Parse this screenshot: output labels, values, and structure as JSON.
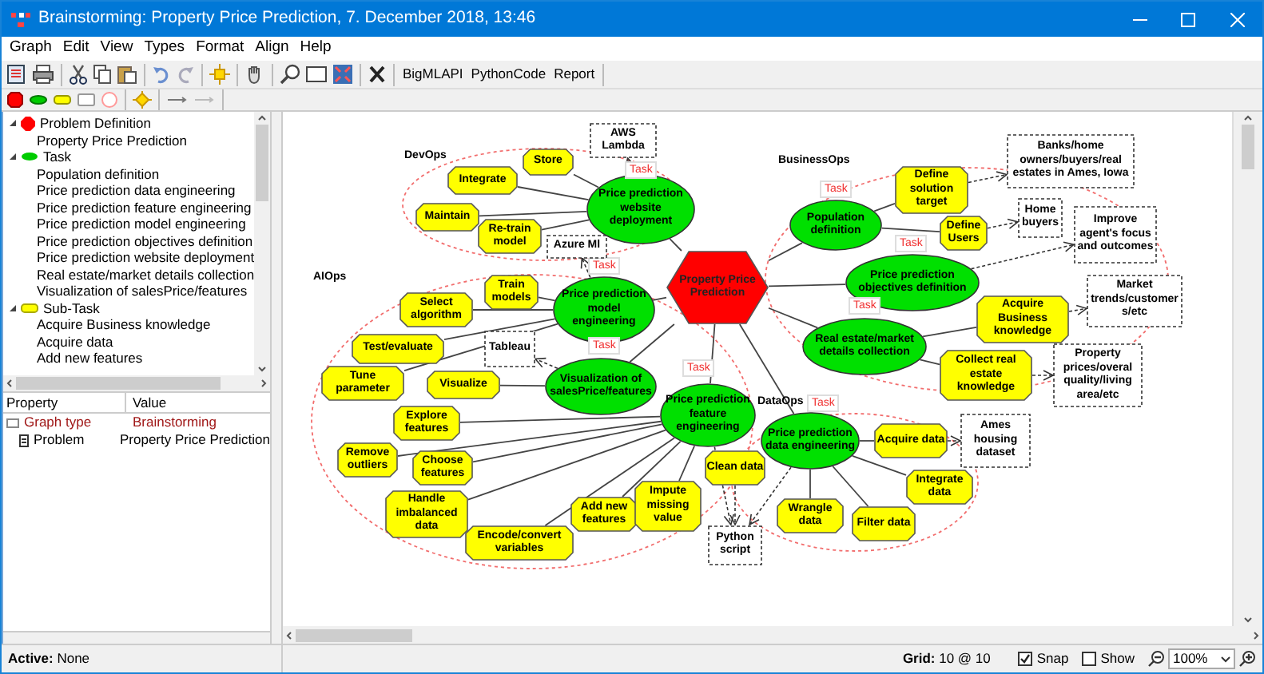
{
  "window": {
    "title": "Brainstorming: Property Price Prediction, 7. December 2018, 13:46"
  },
  "menu": [
    "Graph",
    "Edit",
    "View",
    "Types",
    "Format",
    "Align",
    "Help"
  ],
  "toolbar_buttons": [
    "BigMLAPI",
    "PythonCode",
    "Report"
  ],
  "tree": [
    {
      "label": "Problem Definition",
      "kind": "problem",
      "expanded": true,
      "children": [
        {
          "label": "Property Price Prediction"
        }
      ]
    },
    {
      "label": "Task",
      "kind": "task",
      "expanded": true,
      "children": [
        {
          "label": "Population definition"
        },
        {
          "label": "Price prediction data engineering"
        },
        {
          "label": "Price prediction feature engineering"
        },
        {
          "label": "Price prediction model engineering"
        },
        {
          "label": "Price prediction objectives definition"
        },
        {
          "label": "Price prediction website deployment"
        },
        {
          "label": "Real estate/market details collection"
        },
        {
          "label": "Visualization of salesPrice/features"
        }
      ]
    },
    {
      "label": "Sub-Task",
      "kind": "subtask",
      "expanded": true,
      "children": [
        {
          "label": "Acquire Business knowledge"
        },
        {
          "label": "Acquire data"
        },
        {
          "label": "Add new features"
        }
      ]
    }
  ],
  "properties": {
    "columns": [
      "Property",
      "Value"
    ],
    "rows": [
      {
        "name": "Graph type",
        "value": "Brainstorming",
        "kind": "group"
      },
      {
        "name": "Problem",
        "value": "Property Price Prediction",
        "kind": "item"
      }
    ]
  },
  "groups": [
    {
      "label": "DevOps"
    },
    {
      "label": "AIOps"
    },
    {
      "label": "BusinessOps"
    },
    {
      "label": "DataOps"
    }
  ],
  "nodes": [
    {
      "kind": "problem",
      "text": "Property Price Prediction"
    },
    {
      "kind": "task",
      "text": "Price prediction website deployment",
      "tag": "Task"
    },
    {
      "kind": "task",
      "text": "Price prediction model engineering",
      "tag": "Task"
    },
    {
      "kind": "task",
      "text": "Visualization of salesPrice/features",
      "tag": "Task"
    },
    {
      "kind": "task",
      "text": "Price prediction feature engineering",
      "tag": "Task"
    },
    {
      "kind": "task",
      "text": "Population definition",
      "tag": "Task"
    },
    {
      "kind": "task",
      "text": "Price prediction objectives definition",
      "tag": "Task"
    },
    {
      "kind": "task",
      "text": "Real estate/market details collection",
      "tag": "Task"
    },
    {
      "kind": "task",
      "text": "Price prediction data engineering",
      "tag": "Task"
    },
    {
      "kind": "subtask",
      "text": "Store"
    },
    {
      "kind": "subtask",
      "text": "Integrate"
    },
    {
      "kind": "subtask",
      "text": "Maintain"
    },
    {
      "kind": "subtask",
      "text": "Re-train model"
    },
    {
      "kind": "subtask",
      "text": "Train models"
    },
    {
      "kind": "subtask",
      "text": "Select algorithm"
    },
    {
      "kind": "subtask",
      "text": "Test/evaluate"
    },
    {
      "kind": "subtask",
      "text": "Tune parameter"
    },
    {
      "kind": "subtask",
      "text": "Visualize"
    },
    {
      "kind": "subtask",
      "text": "Explore features"
    },
    {
      "kind": "subtask",
      "text": "Remove outliers"
    },
    {
      "kind": "subtask",
      "text": "Choose features"
    },
    {
      "kind": "subtask",
      "text": "Handle imbalanced data"
    },
    {
      "kind": "subtask",
      "text": "Encode/convert variables"
    },
    {
      "kind": "subtask",
      "text": "Add new features"
    },
    {
      "kind": "subtask",
      "text": "Impute missing value"
    },
    {
      "kind": "subtask",
      "text": "Clean data"
    },
    {
      "kind": "subtask",
      "text": "Define solution target"
    },
    {
      "kind": "subtask",
      "text": "Define Users"
    },
    {
      "kind": "subtask",
      "text": "Acquire Business knowledge"
    },
    {
      "kind": "subtask",
      "text": "Collect real estate knowledge"
    },
    {
      "kind": "subtask",
      "text": "Acquire data"
    },
    {
      "kind": "subtask",
      "text": "Integrate data"
    },
    {
      "kind": "subtask",
      "text": "Wrangle data"
    },
    {
      "kind": "subtask",
      "text": "Filter data"
    },
    {
      "kind": "note",
      "text": "AWS Lambda"
    },
    {
      "kind": "note",
      "text": "Azure Ml"
    },
    {
      "kind": "note",
      "text": "Tableau"
    },
    {
      "kind": "note",
      "text": "Python script"
    },
    {
      "kind": "note",
      "text": "Banks/home owners/buyers/real estates in Ames, Iowa"
    },
    {
      "kind": "note",
      "text": "Home buyers"
    },
    {
      "kind": "note",
      "text": "Improve agent's focus and outcomes"
    },
    {
      "kind": "note",
      "text": "Market trends/customers/etc"
    },
    {
      "kind": "note",
      "text": "Property prices/overal quality/living area/etc"
    },
    {
      "kind": "note",
      "text": "Ames housing dataset"
    }
  ],
  "status_bar": {
    "active": "**Active:** None",
    "grid": "**Grid:** 10 @ 10",
    "snap": {
      "label": "Snap",
      "checked": true
    },
    "show": {
      "label": "Show",
      "checked": false
    },
    "zoom": "100%"
  }
}
